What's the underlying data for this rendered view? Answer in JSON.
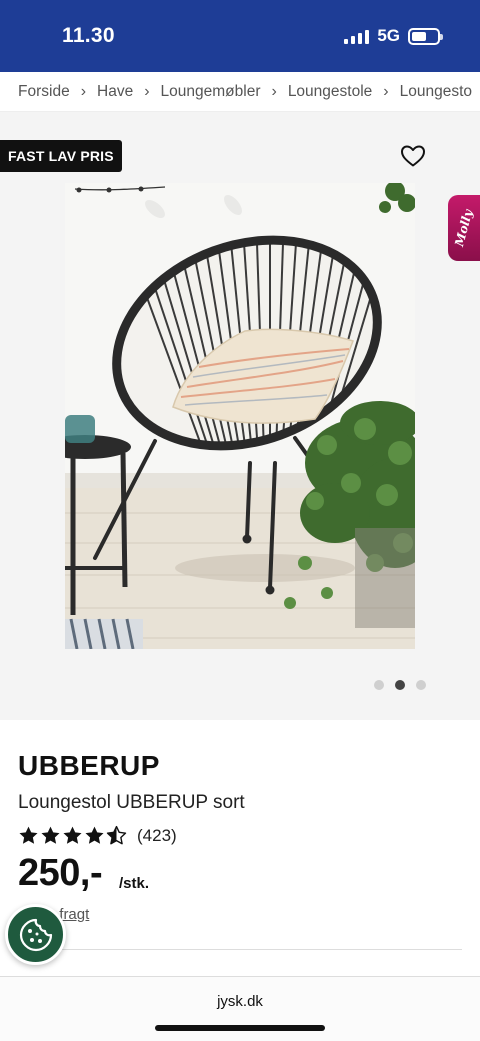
{
  "status_bar": {
    "time": "11.30",
    "network": "5G"
  },
  "breadcrumb": [
    "Forside",
    "Have",
    "Loungemøbler",
    "Loungestole",
    "Loungesto"
  ],
  "gallery": {
    "badge": "FAST LAV PRIS",
    "image_alt": "Loungestol UBBERUP sort",
    "dots_total": 3,
    "active_dot": 2,
    "side_tab": "Molly"
  },
  "product": {
    "brand": "UBBERUP",
    "name": "Loungestol UBBERUP sort",
    "rating_value": 4.5,
    "rating_count": "(423)",
    "price": "250,-",
    "unit": "/stk.",
    "shipping": "+ evt. fragt"
  },
  "browser": {
    "url": "jysk.dk"
  },
  "colors": {
    "header": "#1e3d96",
    "molly": "#c41a6a",
    "cookie": "#1f5a3e"
  }
}
